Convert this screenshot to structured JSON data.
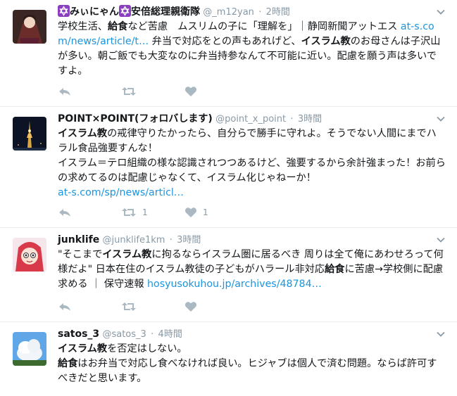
{
  "tweets": [
    {
      "name_prefix": "✡",
      "name_a": "みぃにゃん",
      "name_mid": "✡",
      "name_b": "安倍総理親衛隊",
      "handle": "@_m12yan",
      "time": "2時間",
      "text_1": "学校生活、",
      "text_2": "給食",
      "text_3": "など苦慮　ムスリムの子に「理解を」｜静岡新聞アットエス ",
      "link": "at-s.com/news/article/t…",
      "text_4": " 弁当で対応をとの声もあれげど、",
      "text_5": "イスラム教",
      "text_6": "のお母さんは子沢山が多い。朝ご飯でも大変なのに弁当持参なんて不可能に近い。配慮を願う声は多いですよ。",
      "retweets": "",
      "likes": ""
    },
    {
      "name": "POINT×POINT(フォロバします)",
      "handle": "@point_x_point",
      "time": "3時間",
      "text_1": "イスラム教",
      "text_2": "の戒律守りたかったら、自分らで勝手に守れよ。そうでない人間にまでハラル食品強要すんな！\nイスラム＝テロ組織の様な認識されつつあるけど、強要するから余計強まった！お前らの求めてるのは配慮じゃなくて、イスラム化じゃねーか！\n",
      "link": "at-s.com/sp/news/articl…",
      "retweets": "1",
      "likes": "1"
    },
    {
      "name": "junklife",
      "handle": "@junklife1km",
      "time": "3時間",
      "text_1": "\"そこまで",
      "text_2": "イスラム教",
      "text_3": "に拘るならイスラム圏に居るべき 周りは全て俺にあわせろって何様だよ\" 日本在住のイスラム教徒の子どもがハラール非対応",
      "text_4": "給食",
      "text_5": "に苦慮→学校側に配慮求める ｜ 保守速報 ",
      "link": "hosyusokuhou.jp/archives/48784…",
      "retweets": "",
      "likes": ""
    },
    {
      "name": "satos_3",
      "handle": "@satos_3",
      "time": "4時間",
      "text_1": "イスラム教",
      "text_2": "を否定はしない。\n",
      "text_3": "給食",
      "text_4": "はお弁当で対応し食べなければ良い。ヒジャブは個人で済む問題。ならば許可すべきだと思います。"
    }
  ],
  "colors": {
    "link": "#1b95e0",
    "muted": "#8899a6",
    "divider": "#e6ecf0",
    "star_badge": "#8a3fbf"
  },
  "icons": {
    "reply": "reply-icon",
    "retweet": "retweet-icon",
    "like": "heart-icon",
    "more": "chevron-down-icon",
    "badge": "star-of-david-icon"
  }
}
